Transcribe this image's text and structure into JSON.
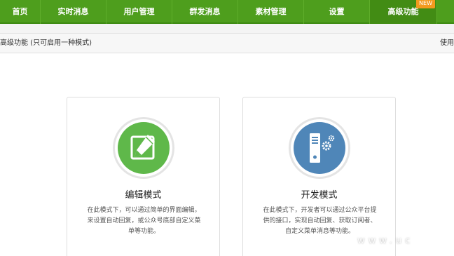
{
  "nav": {
    "items": [
      {
        "label": "首页"
      },
      {
        "label": "实时消息"
      },
      {
        "label": "用户管理"
      },
      {
        "label": "群发消息"
      },
      {
        "label": "素材管理"
      },
      {
        "label": "设置"
      },
      {
        "label": "高级功能",
        "badge": "NEW"
      }
    ],
    "active_index": 6,
    "color": "#4e9e1d"
  },
  "subbar": {
    "title": "高级功能 (只可启用一种模式)",
    "right_text": "使用"
  },
  "cards": [
    {
      "title": "编辑模式",
      "desc_lines": [
        "在此模式下，可以通过简单的界面编辑，",
        "来设置自动回复，或公众号底部自定义菜",
        "单等功能。"
      ],
      "icon": "edit-pencil-icon",
      "color": "#5fb84a"
    },
    {
      "title": "开发模式",
      "desc_lines": [
        "在此模式下，开发者可以通过公众平台提",
        "供的接口，实现自动回复、获取订阅者、",
        "自定义菜单消息等功能。"
      ],
      "icon": "server-gear-icon",
      "color": "#4f86b8"
    }
  ],
  "watermark": "www.uc"
}
